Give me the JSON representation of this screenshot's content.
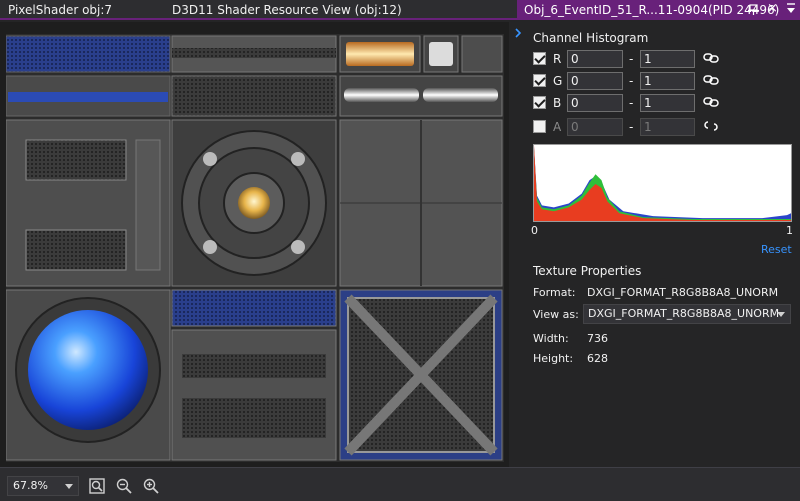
{
  "header": {
    "left_title": "PixelShader obj:7",
    "mid_title": "D3D11 Shader Resource View (obj:12)",
    "active_tab": "Obj_6_EventID_51_R...11-0904(PID 24496)",
    "close_glyph": "×"
  },
  "icons": {
    "pin": "pin-icon",
    "close": "close-icon",
    "dropdown": "chevron-down-icon",
    "collapse": "chevron-right-icon",
    "link": "link-icon",
    "unlink": "unlink-icon",
    "fit": "zoom-fit-icon",
    "zoom_out": "zoom-out-icon",
    "zoom_in": "zoom-in-icon"
  },
  "colors": {
    "accent": "#68217a",
    "link": "#3794ff",
    "hist_red": "#e83d20",
    "hist_green": "#2fbf3a",
    "hist_blue": "#2a46c9"
  },
  "toolbar": {
    "zoom_value": "67.8%"
  },
  "histogram": {
    "title": "Channel Histogram",
    "channels": [
      {
        "label": "R",
        "checked": true,
        "min": "0",
        "max": "1",
        "linked": true,
        "enabled": true
      },
      {
        "label": "G",
        "checked": true,
        "min": "0",
        "max": "1",
        "linked": true,
        "enabled": true
      },
      {
        "label": "B",
        "checked": true,
        "min": "0",
        "max": "1",
        "linked": true,
        "enabled": true
      },
      {
        "label": "A",
        "checked": false,
        "min": "0",
        "max": "1",
        "linked": false,
        "enabled": false
      }
    ],
    "dash": "-",
    "axis_min": "0",
    "axis_max": "1",
    "reset_label": "Reset"
  },
  "properties": {
    "title": "Texture Properties",
    "format_label": "Format:",
    "format_value": "DXGI_FORMAT_R8G8B8A8_UNORM",
    "viewas_label": "View as:",
    "viewas_value": "DXGI_FORMAT_R8G8B8A8_UNORM",
    "width_label": "Width:",
    "width_value": "736",
    "height_label": "Height:",
    "height_value": "628"
  }
}
